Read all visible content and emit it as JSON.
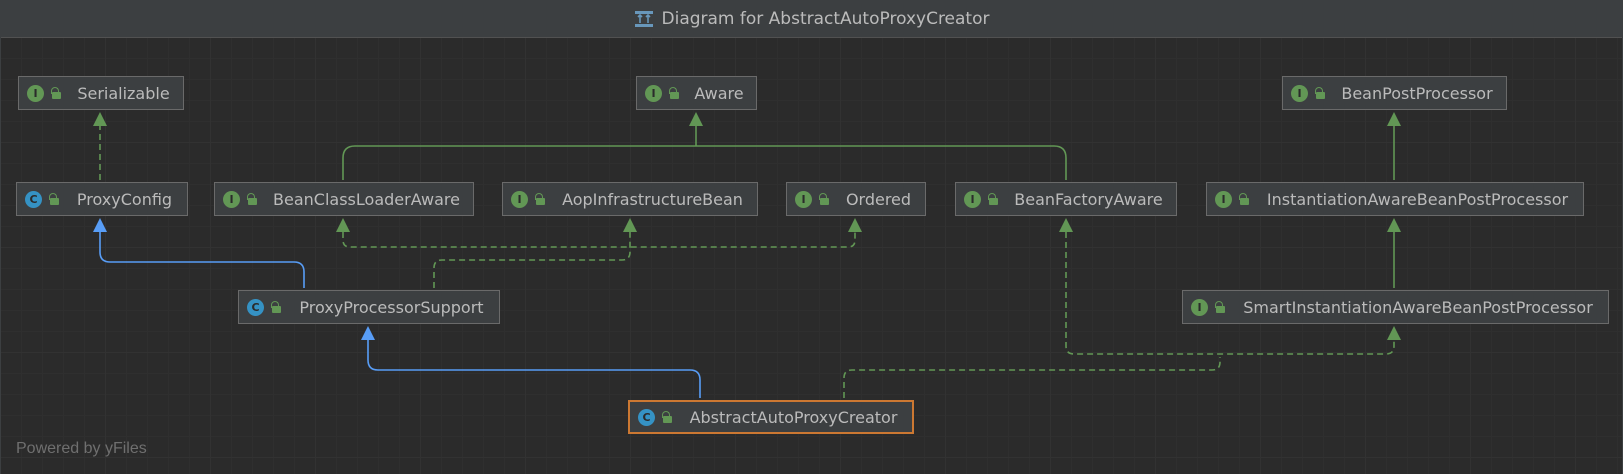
{
  "window": {
    "title": "Diagram for AbstractAutoProxyCreator",
    "title_icon": "diagram-icon"
  },
  "colors": {
    "background": "#2b2b2b",
    "node_fill": "#3c3f41",
    "node_border": "#6a6a6a",
    "interface_badge": "#629755",
    "class_badge": "#3592c4",
    "implements_edge": "#629755",
    "extends_edge": "#589df6",
    "selected_border": "#cc7832"
  },
  "nodes": {
    "serializable": {
      "label": "Serializable",
      "kind": "I"
    },
    "aware": {
      "label": "Aware",
      "kind": "I"
    },
    "bean_post_processor": {
      "label": "BeanPostProcessor",
      "kind": "I"
    },
    "proxy_config": {
      "label": "ProxyConfig",
      "kind": "C"
    },
    "bean_class_loader_aware": {
      "label": "BeanClassLoaderAware",
      "kind": "I"
    },
    "aop_infrastructure_bean": {
      "label": "AopInfrastructureBean",
      "kind": "I"
    },
    "ordered": {
      "label": "Ordered",
      "kind": "I"
    },
    "bean_factory_aware": {
      "label": "BeanFactoryAware",
      "kind": "I"
    },
    "instantiation_aware": {
      "label": "InstantiationAwareBeanPostProcessor",
      "kind": "I"
    },
    "proxy_processor_support": {
      "label": "ProxyProcessorSupport",
      "kind": "C"
    },
    "smart_instantiation_aware": {
      "label": "SmartInstantiationAwareBeanPostProcessor",
      "kind": "I"
    },
    "abstract_auto_proxy_creator": {
      "label": "AbstractAutoProxyCreator",
      "kind": "C",
      "selected": true
    }
  },
  "footer": "Powered by yFiles"
}
